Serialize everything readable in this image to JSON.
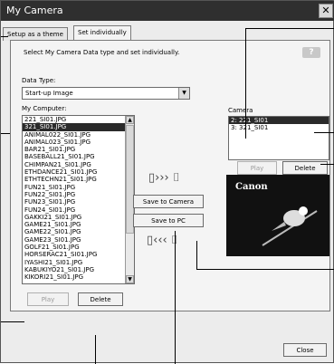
{
  "window": {
    "title": "My Camera",
    "close_glyph": "✕"
  },
  "tabs": [
    {
      "label": "Setup as a theme"
    },
    {
      "label": "Set individually"
    }
  ],
  "instruction": "Select My Camera Data type and set individually.",
  "help_glyph": "?",
  "data_type": {
    "label": "Data Type:",
    "value": "Start-up Image"
  },
  "my_computer": {
    "label": "My Computer:",
    "items": [
      "221_SI01.JPG",
      "321_SI01.JPG",
      "ANIMAL022_SI01.JPG",
      "ANIMAL023_SI01.JPG",
      "BAR21_SI01.JPG",
      "BASEBALL21_SI01.JPG",
      "CHIMPAN21_SI01.JPG",
      "ETHDANCE21_SI01.JPG",
      "ETHTECHN21_SI01.JPG",
      "FUN21_SI01.JPG",
      "FUN22_SI01.JPG",
      "FUN23_SI01.JPG",
      "FUN24_SI01.JPG",
      "GAKKI21_SI01.JPG",
      "GAME21_SI01.JPG",
      "GAME22_SI01.JPG",
      "GAME23_SI01.JPG",
      "GOLF21_SI01.JPG",
      "HORSERAC21_SI01.JPG",
      "IYASHI21_SI01.JPG",
      "KABUKIYO21_SI01.JPG",
      "KIKORI21_SI01.JPG"
    ],
    "selected_index": 1,
    "play_label": "Play",
    "delete_label": "Delete"
  },
  "camera": {
    "label": "Camera",
    "items": [
      "2: 221_SI01",
      "3: 321_SI01"
    ],
    "selected_index": 0,
    "play_label": "Play",
    "delete_label": "Delete",
    "preview_brand": "Canon"
  },
  "transfer": {
    "save_to_camera_label": "Save to Camera",
    "save_to_pc_label": "Save to PC",
    "to_camera_icon": "computer-to-camera-icon",
    "to_pc_icon": "camera-to-computer-icon"
  },
  "footer": {
    "close_label": "Close"
  }
}
